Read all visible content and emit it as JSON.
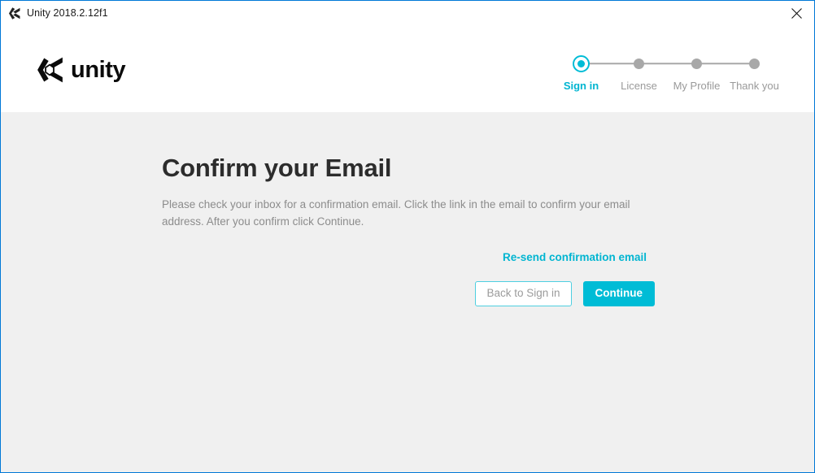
{
  "window": {
    "title": "Unity 2018.2.12f1",
    "title_icon": "unity-logo-icon",
    "close_icon": "close-icon",
    "border_color": "#0078d7"
  },
  "header": {
    "brand": {
      "mark_icon": "unity-cube-icon",
      "word": "unity"
    },
    "stepper": {
      "active_color": "#00bcd6",
      "inactive_color": "#a8a8a8",
      "steps": [
        {
          "label": "Sign in",
          "state": "active"
        },
        {
          "label": "License",
          "state": "inactive"
        },
        {
          "label": "My Profile",
          "state": "inactive"
        },
        {
          "label": "Thank you",
          "state": "inactive"
        }
      ]
    }
  },
  "main": {
    "heading": "Confirm your Email",
    "description": "Please check your inbox for a confirmation email. Click the link in the email to confirm your email address. After you confirm click Continue.",
    "resend_link": "Re-send confirmation email",
    "back_button": "Back to Sign in",
    "continue_button": "Continue",
    "background_color": "#f0f0f0"
  }
}
